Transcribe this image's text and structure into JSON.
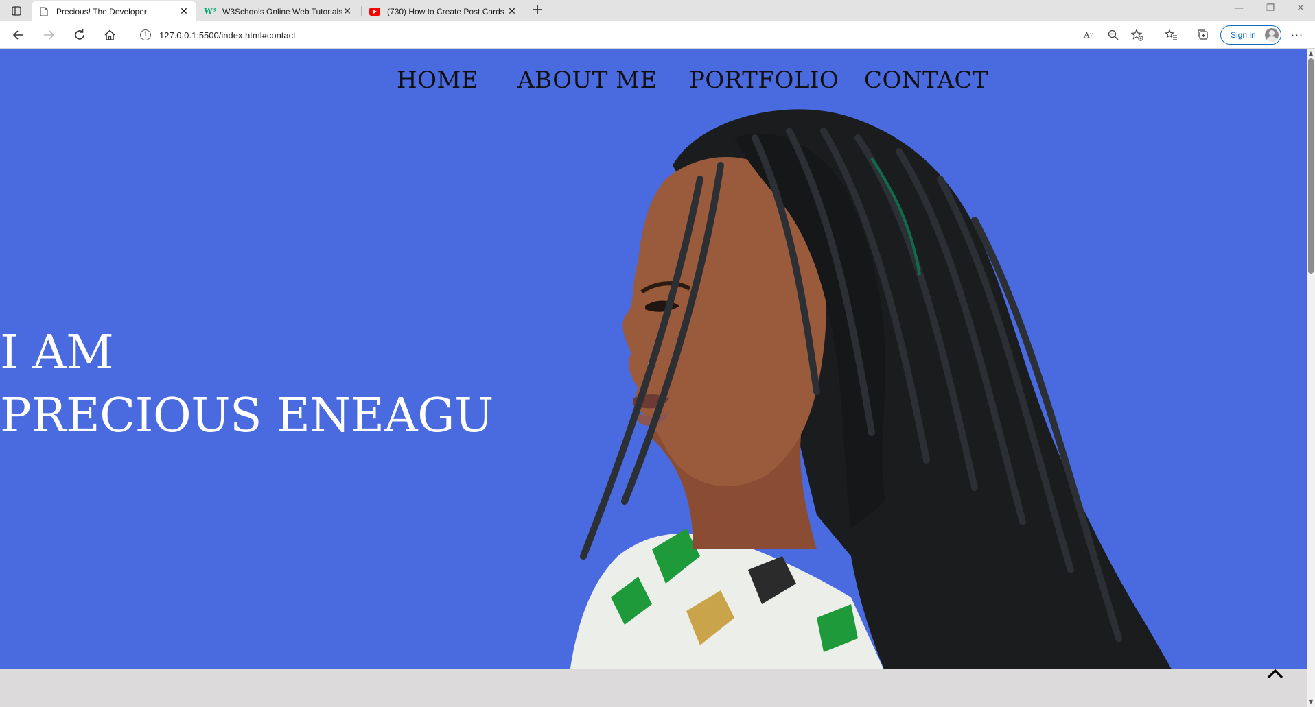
{
  "browser": {
    "tabs": [
      {
        "title": "Precious! The Developer",
        "icon": "page-icon"
      },
      {
        "title": "W3Schools Online Web Tutorials",
        "icon": "w3schools-icon"
      },
      {
        "title": "(730) How to Create Post Cards",
        "icon": "youtube-icon"
      }
    ],
    "url": "127.0.0.1:5500/index.html#contact",
    "sign_in_label": "Sign in"
  },
  "nav": {
    "items": [
      "HOME",
      "ABOUT ME",
      "PORTFOLIO",
      "CONTACT"
    ]
  },
  "hero": {
    "line1": "I AM",
    "line2": "PRECIOUS ENEAGU",
    "background_color": "#4a6ae0",
    "image_alt": "woman-portrait-image"
  },
  "footer_strip_color": "#dcdada"
}
